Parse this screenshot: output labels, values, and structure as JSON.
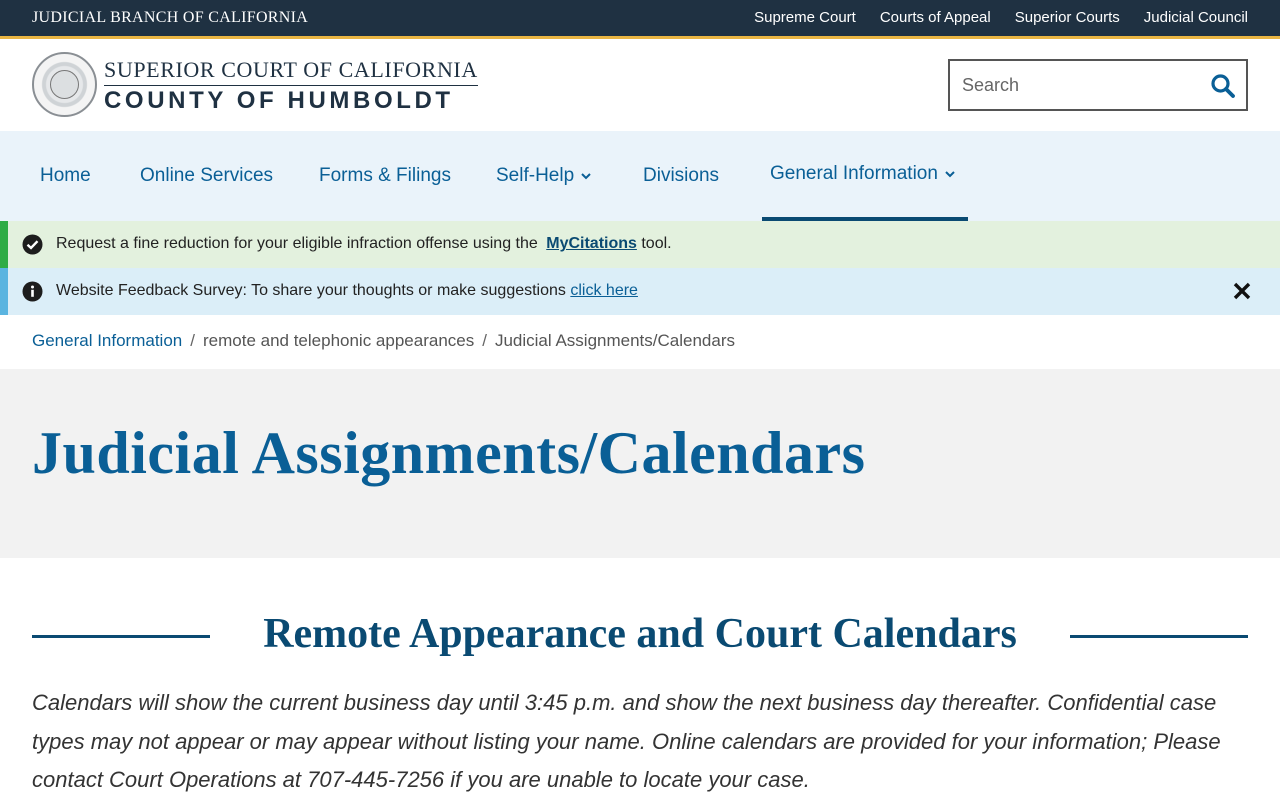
{
  "topbar": {
    "branch_label": "JUDICIAL BRANCH OF CALIFORNIA",
    "links": [
      "Supreme Court",
      "Courts of Appeal",
      "Superior Courts",
      "Judicial Council"
    ]
  },
  "header": {
    "court_line1": "SUPERIOR COURT OF CALIFORNIA",
    "court_line2": "COUNTY OF HUMBOLDT",
    "search_placeholder": "Search"
  },
  "nav": {
    "items": [
      {
        "label": "Home"
      },
      {
        "label": "Online Services"
      },
      {
        "label": "Forms & Filings"
      },
      {
        "label": "Self-Help"
      },
      {
        "label": "Divisions"
      },
      {
        "label": "General Information"
      }
    ]
  },
  "alerts": {
    "fine": {
      "text_before": "Request a fine reduction for your eligible infraction offense using the ",
      "link": "MyCitations",
      "text_after": " tool."
    },
    "survey": {
      "text": "Website Feedback Survey: To share your thoughts or make suggestions ",
      "link": "click here"
    }
  },
  "breadcrumb": {
    "items": [
      "General Information",
      "remote and telephonic appearances",
      "Judicial Assignments/Calendars"
    ],
    "separator": "/"
  },
  "page": {
    "title": "Judicial Assignments/Calendars",
    "section_heading": "Remote Appearance and Court Calendars",
    "body": "Calendars will show the current business day until 3:45 p.m. and show the next business day thereafter.  Confidential case types may not appear or may appear without listing your name.  Online calendars are provided for your information; Please contact Court Operations at 707-445-7256 if you are unable to locate your case."
  },
  "colors": {
    "topbar": "#1f3142",
    "accent": "#e9b543",
    "link": "#0a5f96",
    "nav_bg": "#eaf3fa",
    "alert_green": "#2eac45",
    "alert_blue": "#5ab4e0"
  },
  "icons": [
    "search-icon",
    "chevron-down-icon",
    "check-circle-icon",
    "info-circle-icon",
    "close-icon",
    "court-seal-logo"
  ]
}
